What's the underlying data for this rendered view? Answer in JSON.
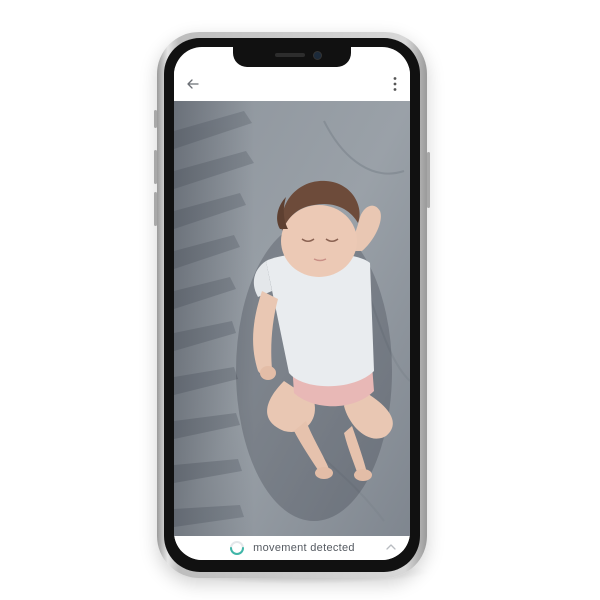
{
  "header": {
    "back_icon": "arrow-left-icon",
    "menu_icon": "more-vertical-icon"
  },
  "feed": {
    "content": "sleeping baby camera view"
  },
  "status": {
    "label": "movement detected",
    "icon": "motion-indicator-icon",
    "expand_icon": "chevron-up-icon",
    "accent_color": "#3fb6a8"
  }
}
